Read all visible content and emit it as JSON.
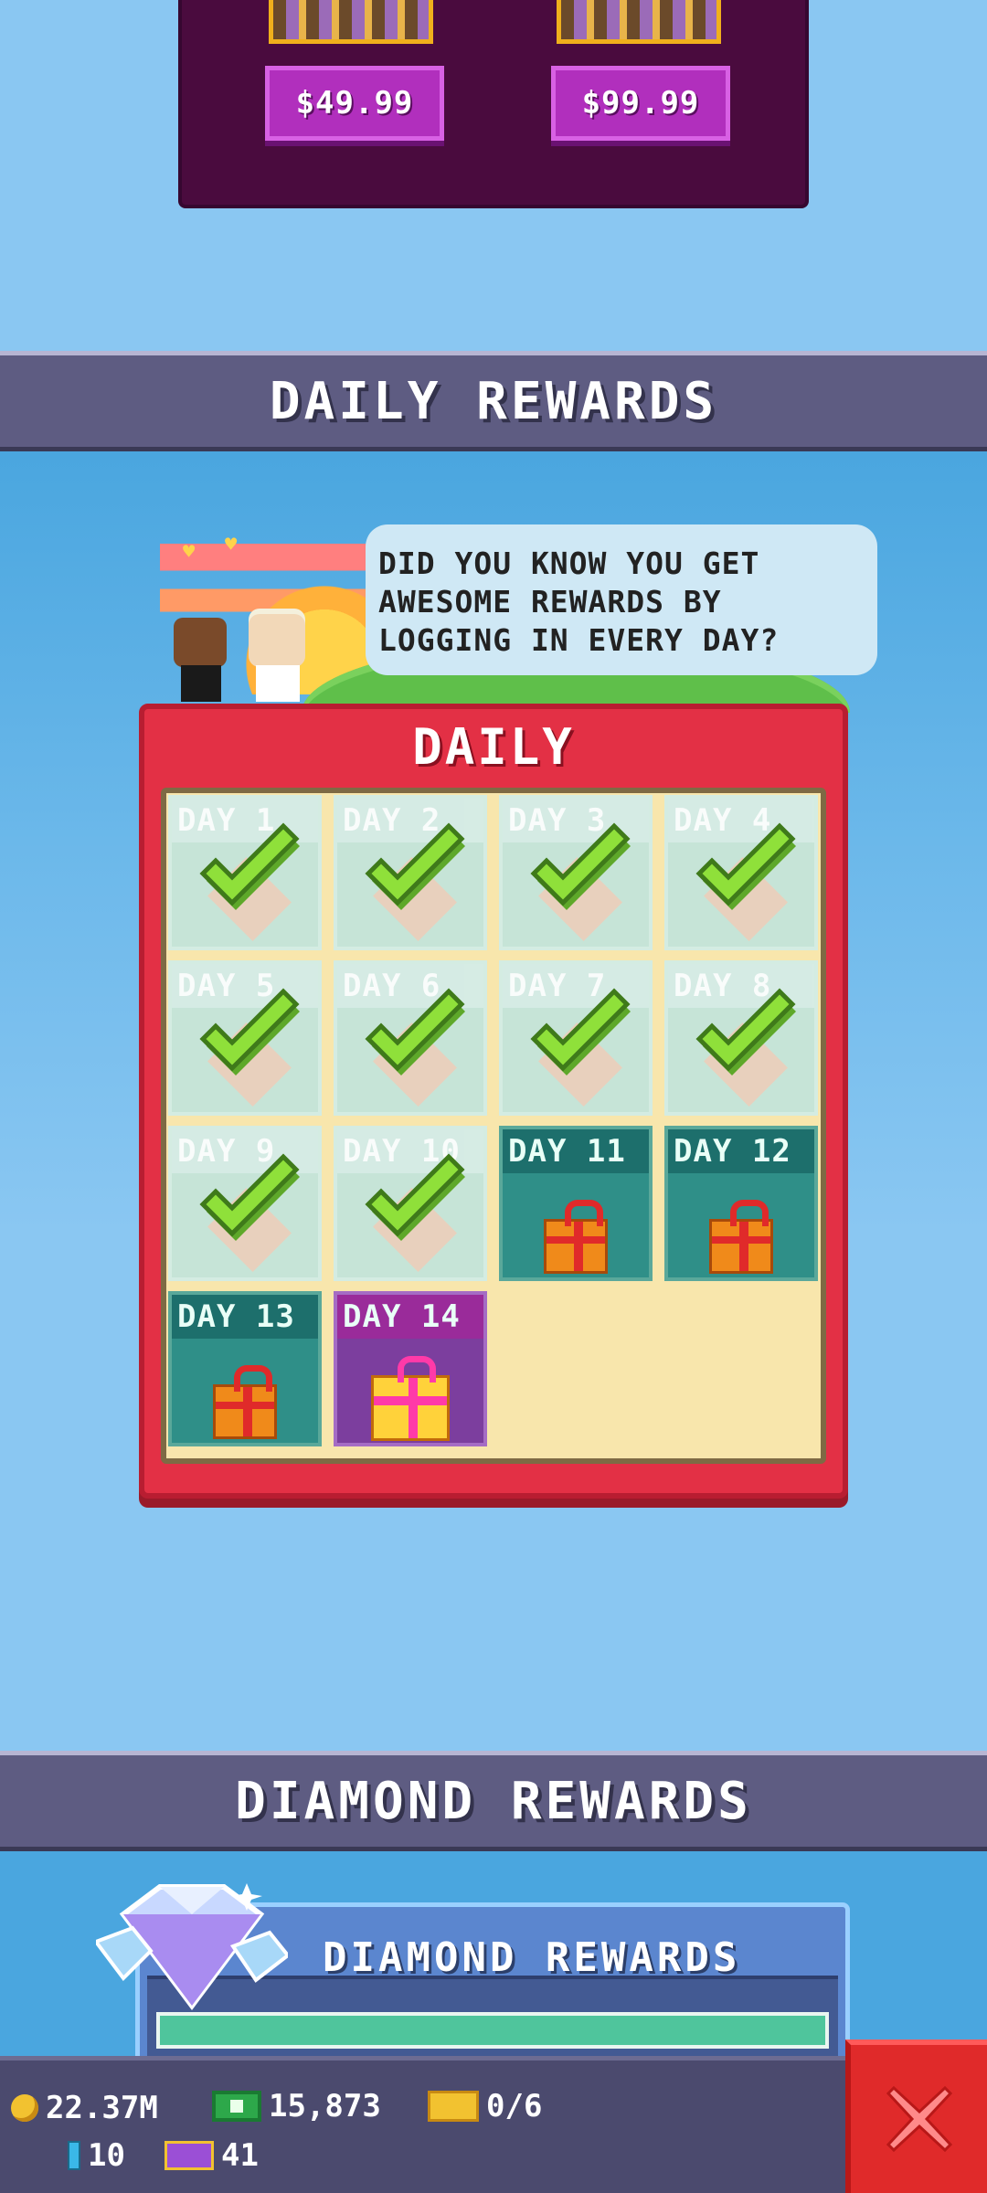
{
  "shop": {
    "price_left": "$49.99",
    "price_right": "$99.99"
  },
  "daily_section": {
    "header": "DAILY REWARDS",
    "speech": "DID YOU KNOW YOU GET AWESOME REWARDS BY LOGGING IN EVERY DAY?",
    "card_title": "DAILY",
    "days": [
      {
        "label": "DAY 1",
        "status": "claimed"
      },
      {
        "label": "DAY 2",
        "status": "claimed"
      },
      {
        "label": "DAY 3",
        "status": "claimed"
      },
      {
        "label": "DAY 4",
        "status": "claimed"
      },
      {
        "label": "DAY 5",
        "status": "claimed"
      },
      {
        "label": "DAY 6",
        "status": "claimed"
      },
      {
        "label": "DAY 7",
        "status": "claimed"
      },
      {
        "label": "DAY 8",
        "status": "claimed"
      },
      {
        "label": "DAY 9",
        "status": "claimed"
      },
      {
        "label": "DAY 10",
        "status": "claimed"
      },
      {
        "label": "DAY 11",
        "status": "gift"
      },
      {
        "label": "DAY 12",
        "status": "gift"
      },
      {
        "label": "DAY 13",
        "status": "gift"
      },
      {
        "label": "DAY 14",
        "status": "special"
      }
    ]
  },
  "diamond_section": {
    "header": "DIAMOND REWARDS",
    "panel_title": "DIAMOND REWARDS"
  },
  "bottom_bar": {
    "coins": "22.37M",
    "cash": "15,873",
    "tickets": "0/6",
    "cards": "10",
    "stars": "41"
  },
  "colors": {
    "sky": "#8ac7f2",
    "header": "#5e5c82",
    "daily_card": "#e33045",
    "claimed_cell": "#c6e4d7",
    "gift_cell": "#2f8f88",
    "special_cell": "#7c3e9e",
    "close_button": "#e02a2a"
  },
  "icons": [
    "coin-icon",
    "cash-icon",
    "ticket-icon",
    "card-icon",
    "star-icon",
    "close-icon",
    "gift-icon",
    "checkmark-icon",
    "diamond-icon"
  ]
}
